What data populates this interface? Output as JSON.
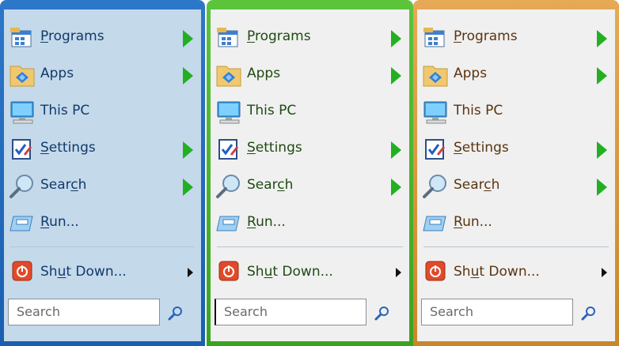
{
  "themes": [
    {
      "id": "blue",
      "accent": "#2d77c9",
      "background": "#c4d9ea",
      "text": "#113a6a"
    },
    {
      "id": "green",
      "accent": "#5cc43a",
      "background": "#f0f0f0",
      "text": "#1f4a12"
    },
    {
      "id": "orange",
      "accent": "#e6a955",
      "background": "#f0f0f0",
      "text": "#5a3410"
    }
  ],
  "menu": {
    "items": [
      {
        "pre": "",
        "ul": "P",
        "post": "rograms",
        "icon": "programs-icon",
        "has_submenu": true
      },
      {
        "pre": "Apps",
        "ul": "",
        "post": "",
        "icon": "apps-folder-icon",
        "has_submenu": true
      },
      {
        "pre": "This PC",
        "ul": "",
        "post": "",
        "icon": "computer-icon",
        "has_submenu": false
      },
      {
        "pre": "",
        "ul": "S",
        "post": "ettings",
        "icon": "settings-icon",
        "has_submenu": true
      },
      {
        "pre": "Sear",
        "ul": "c",
        "post": "h",
        "icon": "search-magnifier-icon",
        "has_submenu": true
      },
      {
        "pre": "",
        "ul": "R",
        "post": "un...",
        "icon": "run-icon",
        "has_submenu": false
      }
    ],
    "shutdown": {
      "pre": "Sh",
      "ul": "u",
      "post": "t Down...",
      "icon": "power-icon"
    },
    "search": {
      "placeholder": "Search"
    }
  }
}
